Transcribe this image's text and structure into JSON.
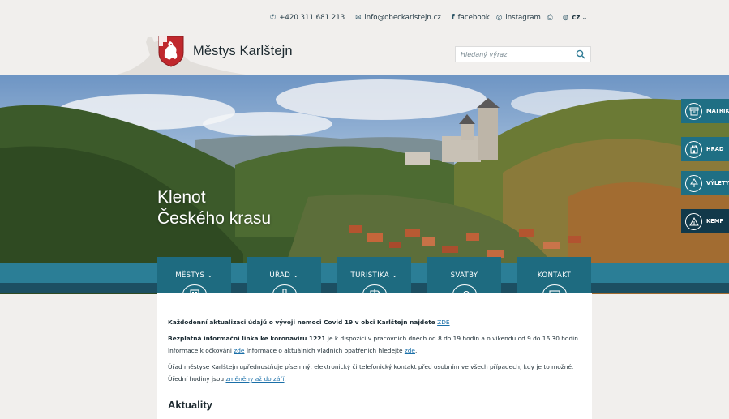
{
  "topbar": {
    "phone": "+420 311 681 213",
    "email": "info@obeckarlstejn.cz",
    "facebook": "facebook",
    "instagram": "instagram",
    "lang": "cz"
  },
  "brand": {
    "name": "Městys Karlštejn"
  },
  "search": {
    "placeholder": "Hledaný výraz"
  },
  "hero": {
    "line1": "Klenot",
    "line2": "Českého krasu"
  },
  "side_buttons": [
    "MATRIKA",
    "HRAD",
    "VÝLETY",
    "KEMP"
  ],
  "nav": [
    {
      "label": "MĚSTYS",
      "chevron": true
    },
    {
      "label": "ÚŘAD",
      "chevron": true
    },
    {
      "label": "TURISTIKA",
      "chevron": true
    },
    {
      "label": "SVATBY",
      "chevron": false
    },
    {
      "label": "KONTAKT",
      "chevron": false
    }
  ],
  "content": {
    "p1_bold": "Každodenní aktualizaci údajů o vývoji nemoci Covid 19 v obci Karlštejn najdete",
    "p1_link": "ZDE",
    "p2_bold": "Bezplatná informační linka ke koronaviru 1221",
    "p2_text": "je k dispozici v pracovních dnech od 8 do 19 hodin a o víkendu od 9 do 16.30 hodin. Informace k očkování",
    "p2_link1": "zde",
    "p2_text2": "Informace o aktuálních vládních opatřeních hledejte",
    "p2_link2": "zde",
    "p3_text": "Úřad městyse Karlštejn upřednostňuje písemný, elektronický či telefonický kontakt před osobním ve všech případech, kdy je to možné. Úřední hodiny jsou",
    "p3_link": "změněny až do září",
    "heading": "Aktuality"
  },
  "colors": {
    "nav": "#1e6b80",
    "band": "#2b7e96",
    "band_dark": "#1c4f62",
    "side_dark": "#12394a",
    "link": "#1a6fa8"
  }
}
